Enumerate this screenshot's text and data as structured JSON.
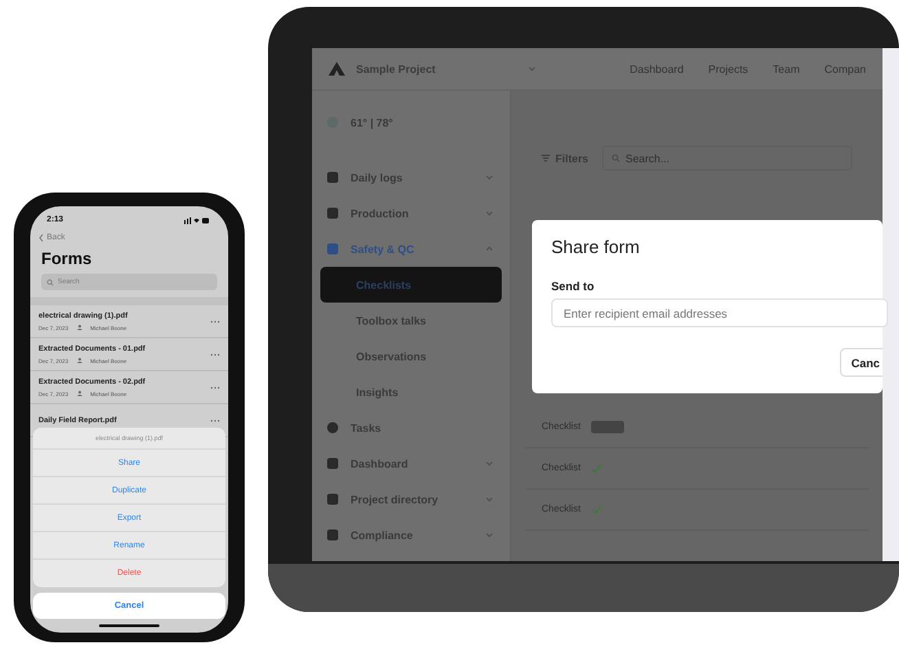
{
  "laptop": {
    "project": "Sample Project",
    "nav": [
      "Dashboard",
      "Projects",
      "Team",
      "Compan"
    ],
    "weather": "61° | 78°",
    "sidebar": [
      {
        "label": "Daily logs",
        "kind": "group",
        "expanded": false,
        "selected": false
      },
      {
        "label": "Production",
        "kind": "group",
        "expanded": false,
        "selected": false
      },
      {
        "label": "Safety & QC",
        "kind": "group",
        "expanded": true,
        "selected": true,
        "children": [
          {
            "label": "Checklists",
            "selected": true
          },
          {
            "label": "Toolbox talks",
            "selected": false
          },
          {
            "label": "Observations",
            "selected": false
          },
          {
            "label": "Insights",
            "selected": false
          }
        ]
      },
      {
        "label": "Tasks",
        "kind": "link",
        "selected": false
      },
      {
        "label": "Dashboard",
        "kind": "group",
        "expanded": false,
        "selected": false
      },
      {
        "label": "Project directory",
        "kind": "group",
        "expanded": false,
        "selected": false
      },
      {
        "label": "Compliance",
        "kind": "group",
        "expanded": false,
        "selected": false
      }
    ],
    "filters": "Filters",
    "search_placeholder": "Search...",
    "rows": [
      {
        "name": "Checklist",
        "kind": "badge"
      },
      {
        "name": "Checklist",
        "kind": "done"
      },
      {
        "name": "Checklist",
        "kind": "done"
      }
    ],
    "modal": {
      "title": "Share form",
      "label": "Send to",
      "placeholder": "Enter recipient email addresses",
      "button": "Canc"
    }
  },
  "phone": {
    "time": "2:13",
    "back": "Back",
    "title": "Forms",
    "search_placeholder": "Search",
    "files": [
      {
        "name": "electrical drawing (1).pdf",
        "date": "Dec 7, 2023",
        "author": "Michael Boone"
      },
      {
        "name": "Extracted Documents - 01.pdf",
        "date": "Dec 7, 2023",
        "author": "Michael Boone"
      },
      {
        "name": "Extracted Documents - 02.pdf",
        "date": "Dec 7, 2023",
        "author": "Michael Boone"
      },
      {
        "name": "Daily Field Report.pdf"
      }
    ],
    "action_sheet": {
      "title": "electrical drawing (1).pdf",
      "actions": [
        {
          "label": "Share",
          "kind": "default"
        },
        {
          "label": "Duplicate",
          "kind": "default"
        },
        {
          "label": "Export",
          "kind": "default"
        },
        {
          "label": "Rename",
          "kind": "default"
        },
        {
          "label": "Delete",
          "kind": "destructive"
        }
      ],
      "cancel": "Cancel"
    }
  }
}
